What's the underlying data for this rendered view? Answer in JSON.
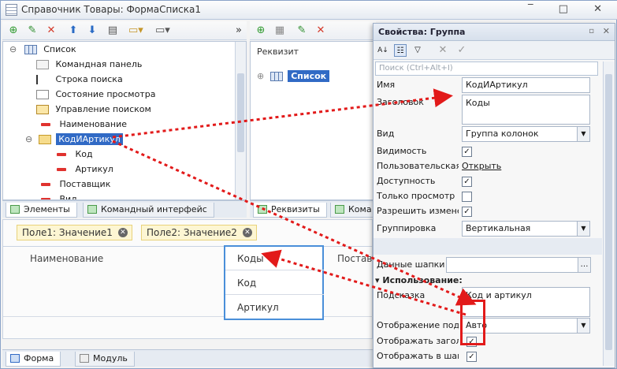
{
  "window": {
    "title": "Справочник Товары: ФормаСписка1"
  },
  "tree": {
    "root": "Список",
    "items": [
      {
        "label": "Командная панель",
        "icon": "command-panel-icon"
      },
      {
        "label": "Строка поиска",
        "icon": "search-string-icon"
      },
      {
        "label": "Состояние просмотра",
        "icon": "view-state-icon"
      },
      {
        "label": "Управление поиском",
        "icon": "search-control-icon"
      },
      {
        "label": "Наименование",
        "icon": "field-icon"
      },
      {
        "label": "КодИАртикул",
        "icon": "group-folder-icon"
      },
      {
        "label": "Код",
        "icon": "field-icon"
      },
      {
        "label": "Артикул",
        "icon": "field-icon"
      },
      {
        "label": "Поставщик",
        "icon": "field-icon"
      },
      {
        "label": "Вид",
        "icon": "field-icon"
      }
    ]
  },
  "left_tabs": [
    "Элементы",
    "Командный интерфейс"
  ],
  "rekvizit": {
    "header": "Реквизит",
    "item": "Список"
  },
  "mid_tabs": [
    "Реквизиты",
    "Кома"
  ],
  "chips": [
    {
      "label": "Поле1: Значение1"
    },
    {
      "label": "Поле2: Значение2"
    }
  ],
  "preview": {
    "col_name": "Наименование",
    "col_supplier": "Постав",
    "group_header": "Коды",
    "group_items": [
      "Код",
      "Артикул"
    ]
  },
  "bottom_tabs": [
    "Форма",
    "Модуль"
  ],
  "props": {
    "title": "Свойства: Группа",
    "search_placeholder": "Поиск (Ctrl+Alt+I)",
    "name_label": "Имя",
    "name_value": "КодИАртикул",
    "header_label": "Заголовок",
    "header_value": "Коды",
    "kind_label": "Вид",
    "kind_value": "Группа колонок",
    "visibility_label": "Видимость",
    "user_visibility_label": "Пользовательская в",
    "user_visibility_link": "Открыть",
    "enabled_label": "Доступность",
    "readonly_label": "Только просмотр",
    "allow_change_label": "Разрешить изменен",
    "grouping_label": "Группировка",
    "grouping_value": "Вертикальная",
    "header_data_label": "Данные шапки",
    "usage_section": "Использование:",
    "hint_label": "Подсказка",
    "hint_value": "Код и артикул",
    "show_label": "Отображение подск",
    "show_value": "Авто",
    "show_header_label": "Отображать заголов",
    "show_in_header_label": "Отображать в шапке"
  },
  "colors": {
    "accent": "#316ac5",
    "arrow": "#e21a1a",
    "highlight_box": "#e21a1a"
  }
}
